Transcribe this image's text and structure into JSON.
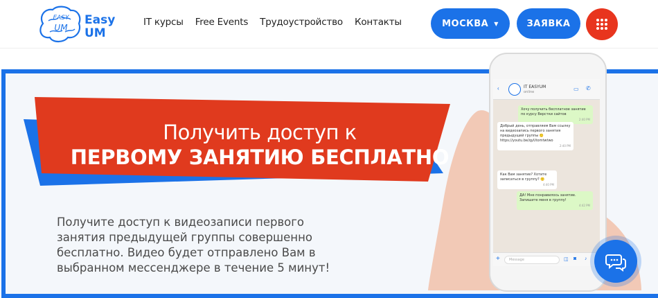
{
  "header": {
    "logo": {
      "text_top": "EASY",
      "text_bottom": "UM",
      "brand_line1": "Easy",
      "brand_line2": "UM"
    },
    "nav": [
      {
        "label": "IT курсы"
      },
      {
        "label": "Free Events"
      },
      {
        "label": "Трудоустройство"
      },
      {
        "label": "Контакты"
      }
    ],
    "city_button": "МОСКВА",
    "request_button": "ЗАЯВКА",
    "menu_icon": "grid-dots-icon"
  },
  "promo": {
    "headline_line1": "Получить доступ к",
    "headline_line2": "ПЕРВОМУ ЗАНЯТИЮ БЕСПЛАТНО",
    "description": "Получите доступ к видеозаписи первого занятия предыдущей группы совершенно бесплатно. Видео будет отправлено Вам в выбранном мессенджере в течение 5 минут!"
  },
  "phone_chat": {
    "contact_name": "IT EASYUM",
    "contact_status": "online",
    "messages": [
      {
        "dir": "out",
        "text": "Хочу получить бесплатное занятие по курсу Верстки сайтов",
        "time": "2:40 PM"
      },
      {
        "dir": "in",
        "text": "Добрый день, отправляем Вам ссылку на видеозапись первого занятия предыдущей группы 🙂 https://youtu.be/qyUtomtwtwo",
        "time": "2:40 PM"
      },
      {
        "dir": "in",
        "text": "Как Вам занятие? Хотите записаться в группу? 🙂",
        "time": "4:40 PM"
      },
      {
        "dir": "out",
        "text": "ДА! Мне понравилось занятие. Запишите меня в группу!",
        "time": "4:42 PM"
      }
    ],
    "input_placeholder": "Message"
  },
  "colors": {
    "primary_blue": "#1b72e8",
    "accent_red": "#e8351e",
    "banner_red": "#e03a1e"
  }
}
